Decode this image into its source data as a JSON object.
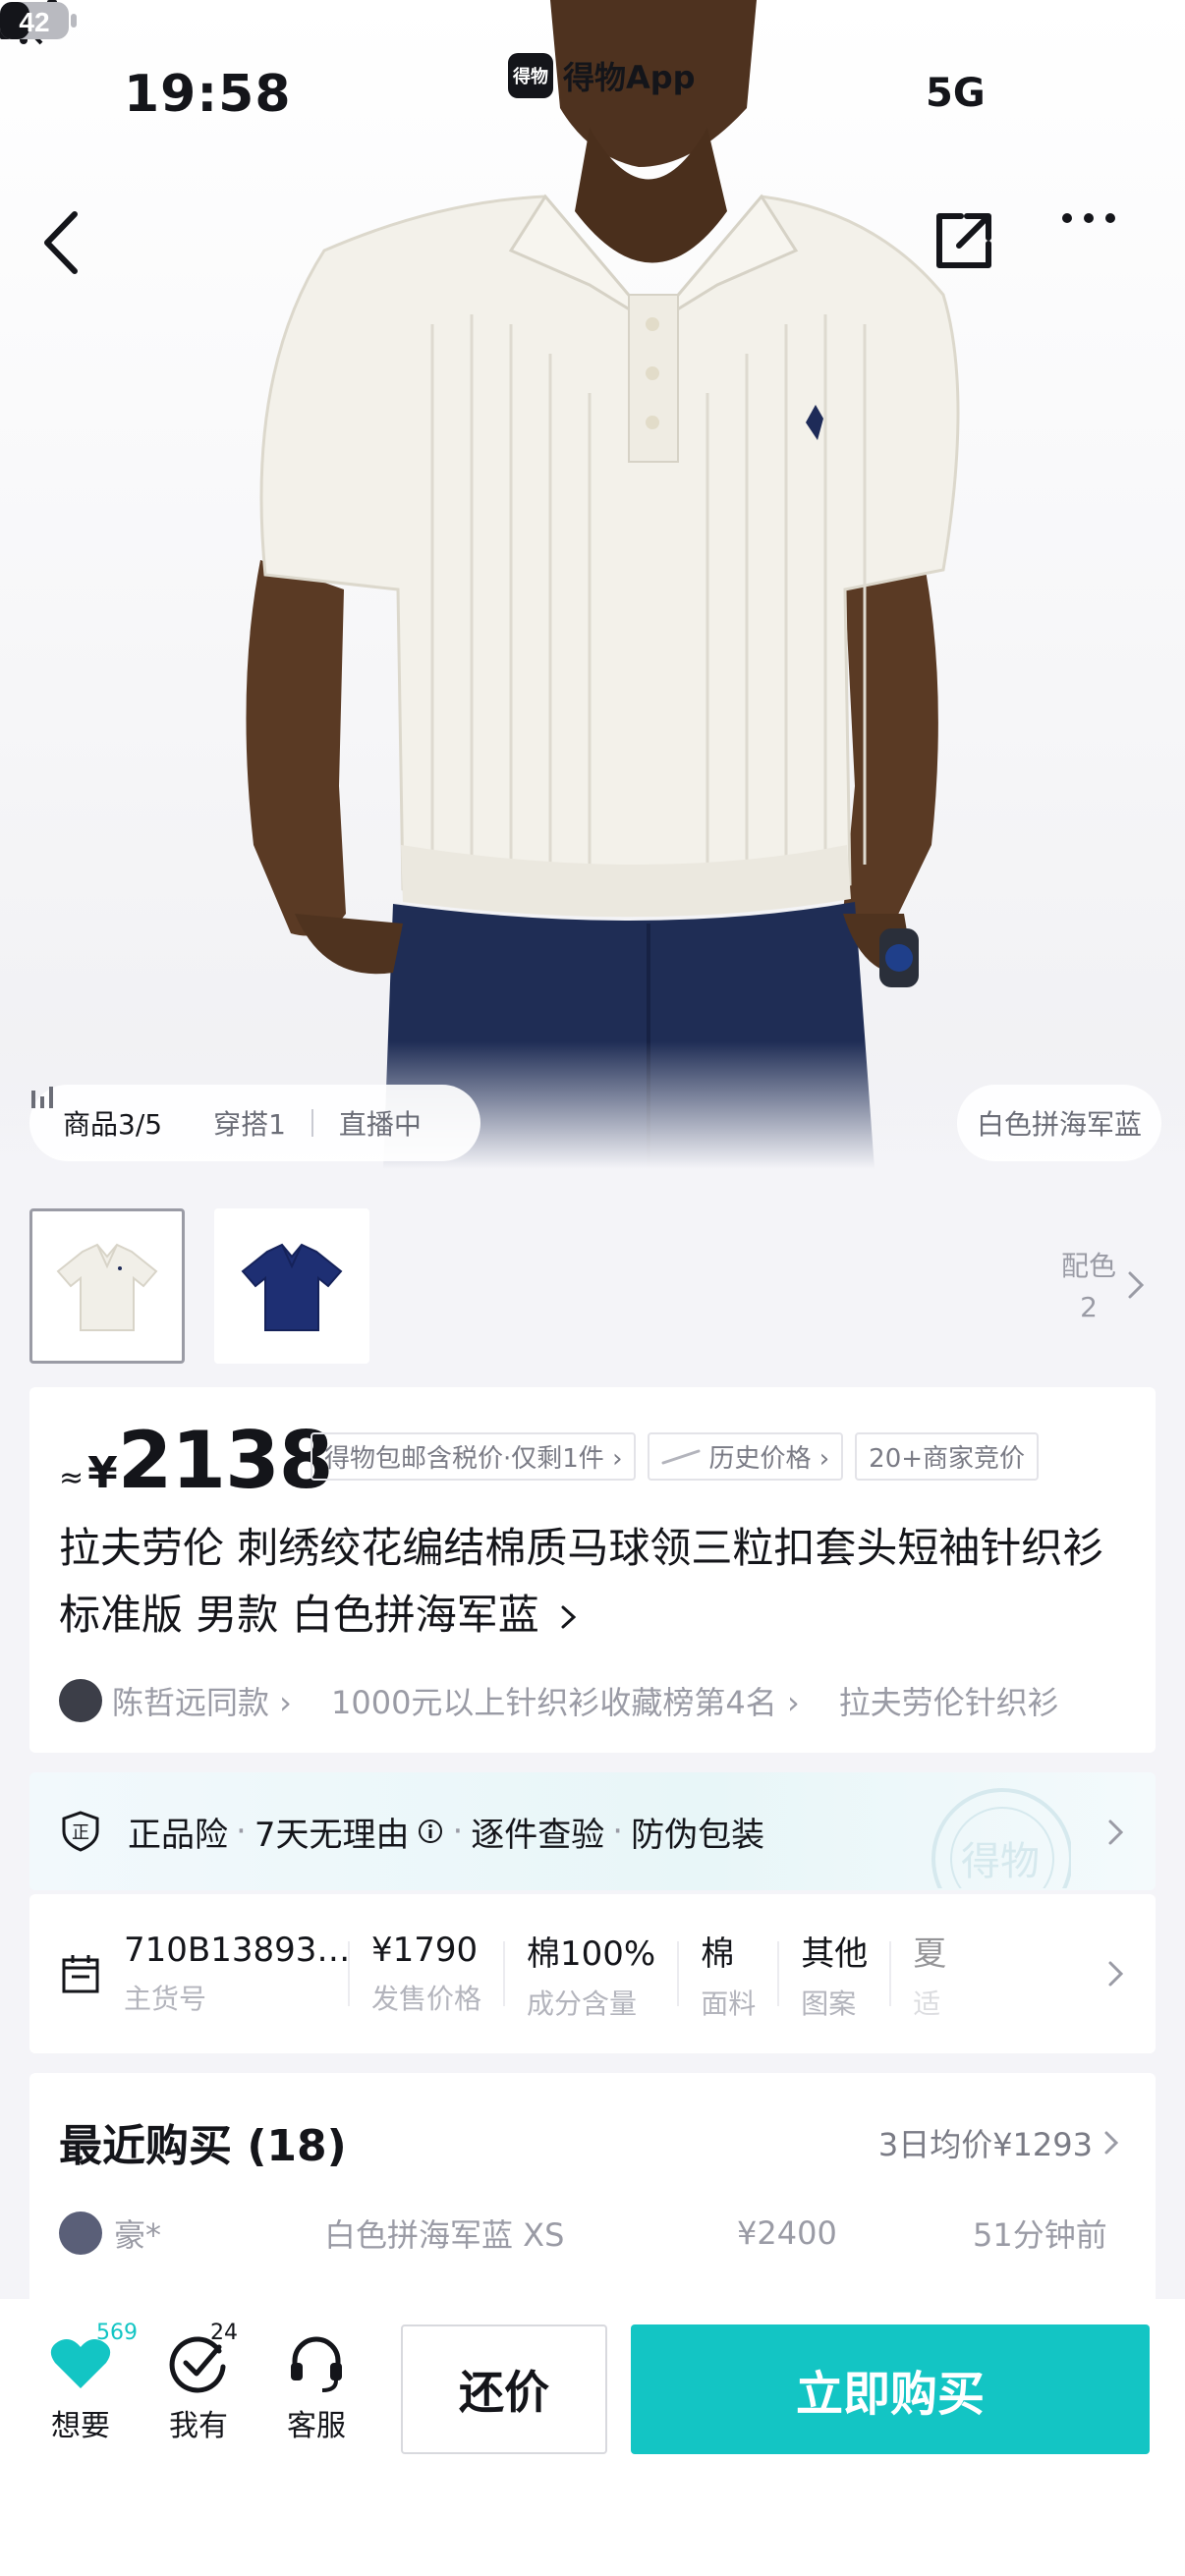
{
  "status_bar": {
    "time": "19:58",
    "app_name": "得物App",
    "app_logo": "得物",
    "network": "5G",
    "battery": "42"
  },
  "hero": {
    "badges": [
      "商品3/5",
      "穿搭1",
      "直播中"
    ],
    "color_name": "白色拼海军蓝"
  },
  "colors": {
    "label": "配色",
    "count": "2"
  },
  "price": {
    "approx": "≈",
    "currency": "¥",
    "value": "2138",
    "chips": [
      "得物包邮含税价·仅剩1件 ›",
      "历史价格 ›",
      "20+商家竞价"
    ]
  },
  "product": {
    "title": "拉夫劳伦 刺绣绞花编结棉质马球领三粒扣套头短袖针织衫 标准版 男款 白色拼海军蓝",
    "tags": [
      "陈哲远同款 ›",
      "1000元以上针织衫收藏榜第4名 ›",
      "拉夫劳伦针织衫"
    ]
  },
  "guarantee": {
    "items": [
      "正品险",
      "7天无理由",
      "逐件查验",
      "防伪包装"
    ],
    "stamp": "得物"
  },
  "specs": [
    {
      "value": "710B13893…",
      "key": "主货号"
    },
    {
      "value": "¥1790",
      "key": "发售价格"
    },
    {
      "value": "棉100%",
      "key": "成分含量"
    },
    {
      "value": "棉",
      "key": "面料"
    },
    {
      "value": "其他",
      "key": "图案"
    },
    {
      "value": "夏",
      "key": "适"
    }
  ],
  "recent": {
    "title": "最近购买 (18)",
    "avg": "3日均价¥1293",
    "rows": [
      {
        "user": "豪*",
        "spec": "白色拼海军蓝 XS",
        "price": "¥2400",
        "time": "51分钟前"
      }
    ]
  },
  "bottom_bar": {
    "want": {
      "label": "想要",
      "count": "569"
    },
    "have": {
      "label": "我有",
      "count": "24"
    },
    "service": {
      "label": "客服"
    },
    "offer": "还价",
    "buy": "立即购买"
  },
  "accent_color": "#13c5c4"
}
